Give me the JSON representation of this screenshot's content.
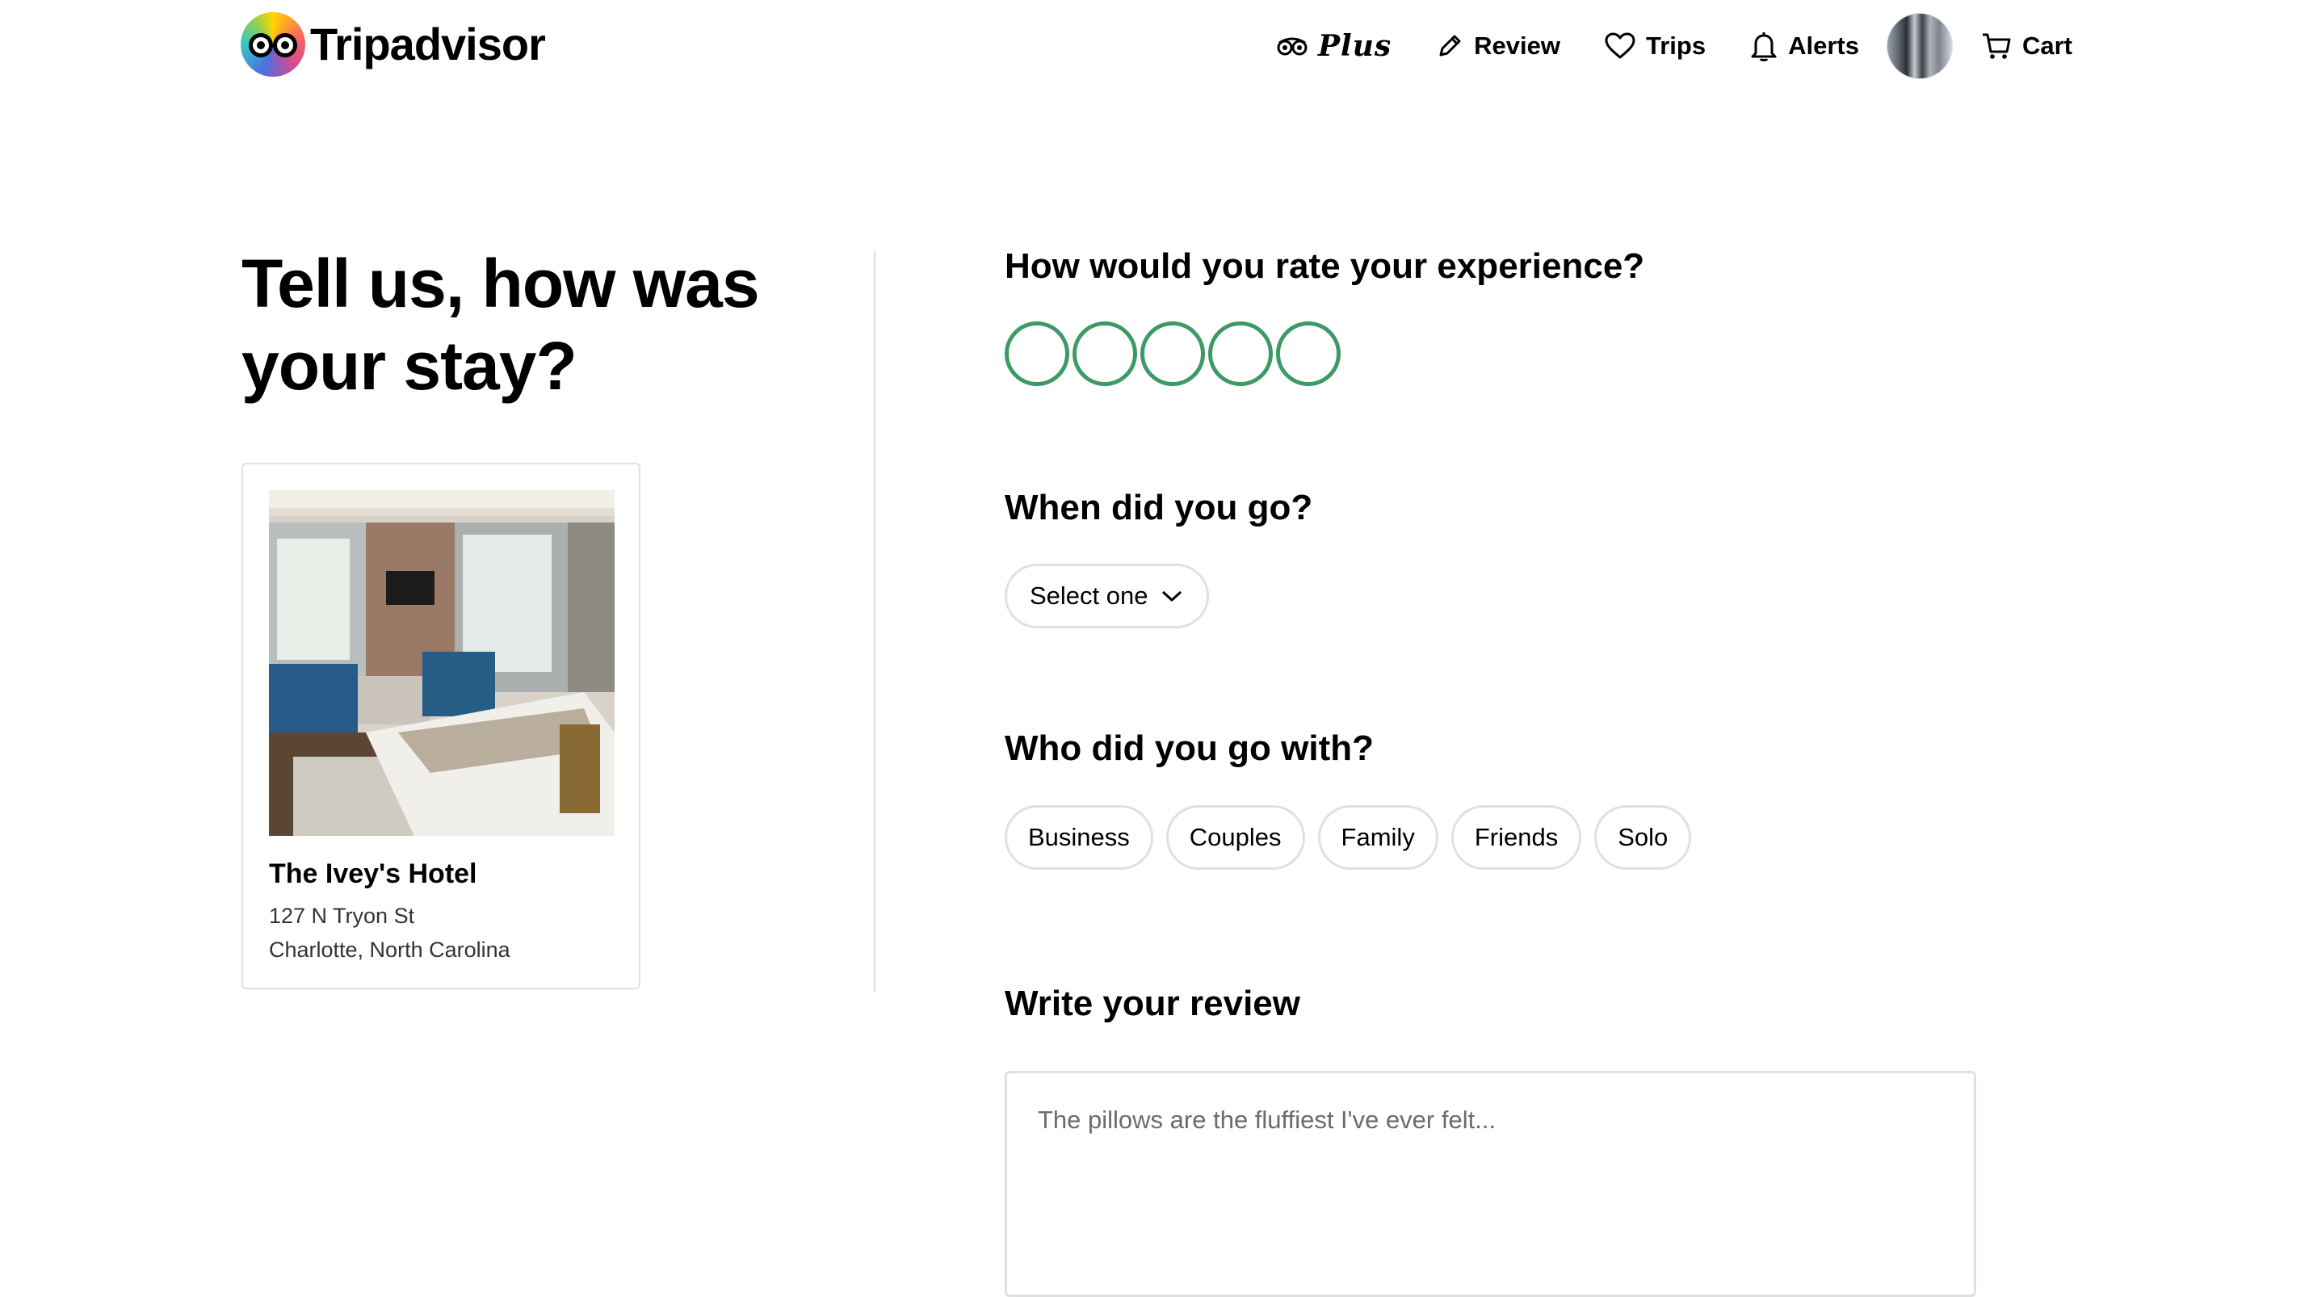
{
  "brand": {
    "name": "Tripadvisor"
  },
  "nav": {
    "plus_label": "Plus",
    "review_label": "Review",
    "trips_label": "Trips",
    "alerts_label": "Alerts",
    "cart_label": "Cart"
  },
  "page": {
    "headline": "Tell us, how was your stay?"
  },
  "hotel": {
    "name": "The Ivey's Hotel",
    "address_line1": "127 N Tryon St",
    "address_line2": "Charlotte, North Carolina"
  },
  "rating": {
    "question": "How would you rate your experience?",
    "max": 5,
    "value": 0,
    "accent_color": "#3c9a64"
  },
  "when": {
    "question": "When did you go?",
    "select_label": "Select one"
  },
  "who": {
    "question": "Who did you go with?",
    "options": [
      "Business",
      "Couples",
      "Family",
      "Friends",
      "Solo"
    ]
  },
  "review": {
    "title": "Write your review",
    "placeholder": "The pillows are the fluffiest I've ever felt..."
  },
  "icons": {
    "plus": "binoculars-icon",
    "review": "pencil-icon",
    "trips": "heart-icon",
    "alerts": "bell-icon",
    "cart": "cart-icon",
    "select": "chevron-down-icon"
  }
}
